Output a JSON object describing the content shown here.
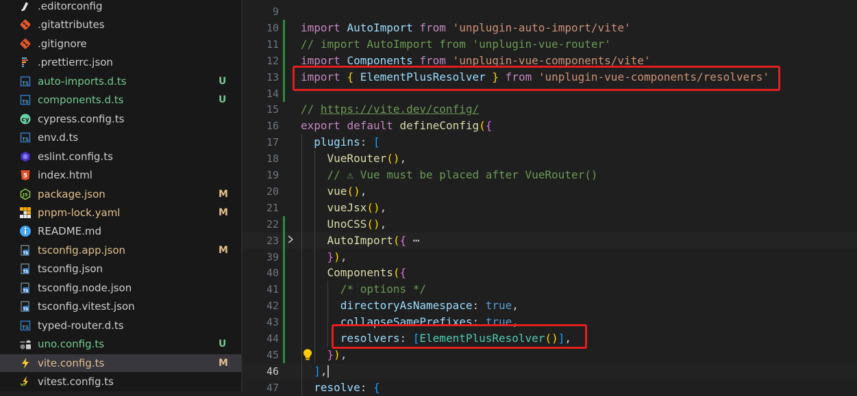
{
  "explorer": {
    "files": [
      {
        "name": ".editorconfig",
        "status": "",
        "icon": "editorconfig-icon",
        "color": "#cccccc"
      },
      {
        "name": ".gitattributes",
        "status": "",
        "icon": "git-icon",
        "color": "#cccccc"
      },
      {
        "name": ".gitignore",
        "status": "",
        "icon": "git-icon",
        "color": "#cccccc"
      },
      {
        "name": ".prettierrc.json",
        "status": "",
        "icon": "prettier-icon",
        "color": "#cccccc"
      },
      {
        "name": "auto-imports.d.ts",
        "status": "U",
        "icon": "typescript-def-icon",
        "color": "#73c991"
      },
      {
        "name": "components.d.ts",
        "status": "U",
        "icon": "typescript-def-icon",
        "color": "#73c991"
      },
      {
        "name": "cypress.config.ts",
        "status": "",
        "icon": "cypress-icon",
        "color": "#cccccc"
      },
      {
        "name": "env.d.ts",
        "status": "",
        "icon": "typescript-def-icon",
        "color": "#cccccc"
      },
      {
        "name": "eslint.config.ts",
        "status": "",
        "icon": "eslint-icon",
        "color": "#cccccc"
      },
      {
        "name": "index.html",
        "status": "",
        "icon": "html-icon",
        "color": "#cccccc"
      },
      {
        "name": "package.json",
        "status": "M",
        "icon": "nodejs-icon",
        "color": "#e2c08d"
      },
      {
        "name": "pnpm-lock.yaml",
        "status": "M",
        "icon": "pnpm-icon",
        "color": "#e2c08d"
      },
      {
        "name": "README.md",
        "status": "",
        "icon": "info-icon",
        "color": "#cccccc"
      },
      {
        "name": "tsconfig.app.json",
        "status": "M",
        "icon": "tsconfig-icon",
        "color": "#e2c08d"
      },
      {
        "name": "tsconfig.json",
        "status": "",
        "icon": "tsconfig-icon",
        "color": "#cccccc"
      },
      {
        "name": "tsconfig.node.json",
        "status": "",
        "icon": "tsconfig-icon",
        "color": "#cccccc"
      },
      {
        "name": "tsconfig.vitest.json",
        "status": "",
        "icon": "tsconfig-icon",
        "color": "#cccccc"
      },
      {
        "name": "typed-router.d.ts",
        "status": "",
        "icon": "typescript-def-icon",
        "color": "#cccccc"
      },
      {
        "name": "uno.config.ts",
        "status": "U",
        "icon": "unocss-icon",
        "color": "#73c991"
      },
      {
        "name": "vite.config.ts",
        "status": "M",
        "icon": "vite-icon",
        "color": "#e2c08d"
      },
      {
        "name": "vitest.config.ts",
        "status": "",
        "icon": "vitest-icon",
        "color": "#cccccc"
      }
    ],
    "selected_index": 19
  },
  "editor": {
    "lines": [
      {
        "num": "9",
        "tokens": []
      },
      {
        "num": "10",
        "tokens": [
          [
            "kw",
            "import"
          ],
          [
            "pl",
            " "
          ],
          [
            "var",
            "AutoImport"
          ],
          [
            "pl",
            " "
          ],
          [
            "kw",
            "from"
          ],
          [
            "pl",
            " "
          ],
          [
            "str",
            "'unplugin-auto-import/vite'"
          ]
        ]
      },
      {
        "num": "11",
        "tokens": [
          [
            "cm",
            "// import AutoImport from 'unplugin-vue-router'"
          ]
        ]
      },
      {
        "num": "12",
        "tokens": [
          [
            "kw",
            "import"
          ],
          [
            "pl",
            " "
          ],
          [
            "var",
            "Components"
          ],
          [
            "pl",
            " "
          ],
          [
            "kw",
            "from"
          ],
          [
            "pl",
            " "
          ],
          [
            "str",
            "'unplugin-vue-components/vite'"
          ]
        ]
      },
      {
        "num": "13",
        "tokens": [
          [
            "kw",
            "import"
          ],
          [
            "pl",
            " "
          ],
          [
            "b1",
            "{"
          ],
          [
            "pl",
            " "
          ],
          [
            "var",
            "ElementPlusResolver"
          ],
          [
            "pl",
            " "
          ],
          [
            "b1",
            "}"
          ],
          [
            "pl",
            " "
          ],
          [
            "kw",
            "from"
          ],
          [
            "pl",
            " "
          ],
          [
            "str",
            "'unplugin-vue-components/resolvers'"
          ]
        ]
      },
      {
        "num": "14",
        "tokens": []
      },
      {
        "num": "15",
        "tokens": [
          [
            "cm",
            "// https://vite.dev/config/"
          ]
        ]
      },
      {
        "num": "16",
        "tokens": [
          [
            "kw",
            "export"
          ],
          [
            "pl",
            " "
          ],
          [
            "kw",
            "default"
          ],
          [
            "pl",
            " "
          ],
          [
            "fn",
            "defineConfig"
          ],
          [
            "b1",
            "("
          ],
          [
            "b2",
            "{"
          ]
        ]
      },
      {
        "num": "17",
        "tokens": [
          [
            "pl",
            "  "
          ],
          [
            "var",
            "plugins"
          ],
          [
            "pl",
            ": "
          ],
          [
            "b3",
            "["
          ]
        ]
      },
      {
        "num": "18",
        "tokens": [
          [
            "pl",
            "    "
          ],
          [
            "fn",
            "VueRouter"
          ],
          [
            "b1",
            "()"
          ],
          [
            "pl",
            ","
          ]
        ]
      },
      {
        "num": "19",
        "tokens": [
          [
            "pl",
            "    "
          ],
          [
            "cm",
            "// ⚠ Vue must be placed after VueRouter()"
          ]
        ]
      },
      {
        "num": "20",
        "tokens": [
          [
            "pl",
            "    "
          ],
          [
            "fn",
            "vue"
          ],
          [
            "b1",
            "()"
          ],
          [
            "pl",
            ","
          ]
        ]
      },
      {
        "num": "21",
        "tokens": [
          [
            "pl",
            "    "
          ],
          [
            "fn",
            "vueJsx"
          ],
          [
            "b1",
            "()"
          ],
          [
            "pl",
            ","
          ]
        ]
      },
      {
        "num": "22",
        "tokens": [
          [
            "pl",
            "    "
          ],
          [
            "fn",
            "UnoCSS"
          ],
          [
            "b1",
            "()"
          ],
          [
            "pl",
            ","
          ]
        ]
      },
      {
        "num": "23",
        "tokens": [
          [
            "pl",
            "    "
          ],
          [
            "fn",
            "AutoImport"
          ],
          [
            "b1",
            "("
          ],
          [
            "b2",
            "{"
          ],
          [
            "pl",
            " ⋯"
          ]
        ]
      },
      {
        "num": "39",
        "tokens": [
          [
            "pl",
            "    "
          ],
          [
            "b2",
            "}"
          ],
          [
            "b1",
            ")"
          ],
          [
            "pl",
            ","
          ]
        ]
      },
      {
        "num": "40",
        "tokens": [
          [
            "pl",
            "    "
          ],
          [
            "fn",
            "Components"
          ],
          [
            "b1",
            "("
          ],
          [
            "b2",
            "{"
          ]
        ]
      },
      {
        "num": "41",
        "tokens": [
          [
            "pl",
            "      "
          ],
          [
            "cm",
            "/* options */"
          ]
        ]
      },
      {
        "num": "42",
        "tokens": [
          [
            "pl",
            "      "
          ],
          [
            "var",
            "directoryAsNamespace"
          ],
          [
            "pl",
            ": "
          ],
          [
            "kb",
            "true"
          ],
          [
            "pl",
            ","
          ]
        ]
      },
      {
        "num": "43",
        "tokens": [
          [
            "pl",
            "      "
          ],
          [
            "var",
            "collapseSamePrefixes"
          ],
          [
            "pl",
            ": "
          ],
          [
            "kb",
            "true"
          ],
          [
            "pl",
            ","
          ]
        ]
      },
      {
        "num": "44",
        "tokens": [
          [
            "pl",
            "      "
          ],
          [
            "var",
            "resolvers"
          ],
          [
            "pl",
            ": "
          ],
          [
            "b3",
            "["
          ],
          [
            "cls",
            "ElementPlusResolver"
          ],
          [
            "b1",
            "()"
          ],
          [
            "b3",
            "]"
          ],
          [
            "pl",
            ","
          ]
        ]
      },
      {
        "num": "45",
        "tokens": [
          [
            "pl",
            "    "
          ],
          [
            "b2",
            "}"
          ],
          [
            "b1",
            ")"
          ],
          [
            "pl",
            ","
          ]
        ]
      },
      {
        "num": "46",
        "tokens": [
          [
            "pl",
            "  "
          ],
          [
            "b3",
            "]"
          ],
          [
            "pl",
            ","
          ]
        ]
      },
      {
        "num": "47",
        "tokens": [
          [
            "pl",
            "  "
          ],
          [
            "var",
            "resolve"
          ],
          [
            "pl",
            ": "
          ],
          [
            "b3",
            "{"
          ]
        ]
      }
    ],
    "current_line": "46"
  },
  "colors": {
    "highlight_box": "#e51e1e",
    "git_added": "#2ea043",
    "untracked": "#73c991",
    "modified": "#e2c08d"
  }
}
